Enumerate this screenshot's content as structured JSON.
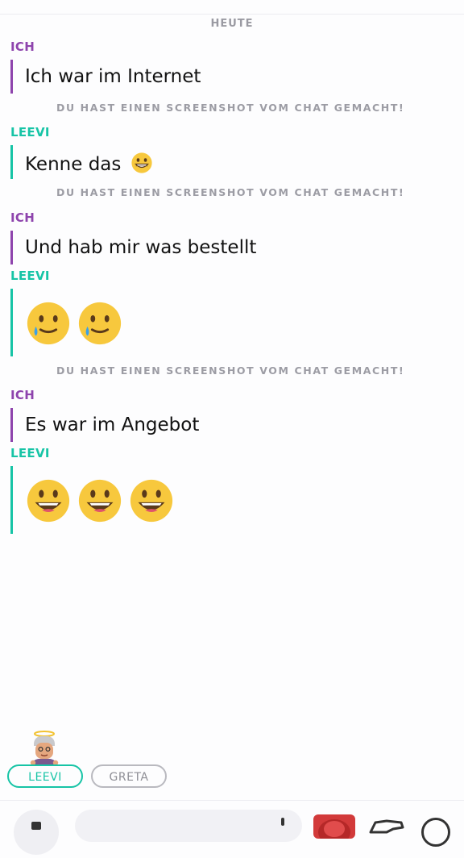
{
  "chat": {
    "date_label": "HEUTE",
    "messages": [
      {
        "sender": "ICH",
        "text": "Ich war im Internet"
      },
      {
        "notice": "DU HAST EINEN SCREENSHOT VOM CHAT GEMACHT!"
      },
      {
        "sender": "LEEVI",
        "text": "Kenne das",
        "emoji": "grinning-face-icon"
      },
      {
        "notice": "DU HAST EINEN SCREENSHOT VOM CHAT GEMACHT!"
      },
      {
        "sender": "ICH",
        "text": "Und hab mir was bestellt"
      },
      {
        "sender": "LEEVI",
        "emojis": [
          "smiling-face-with-tear-icon",
          "smiling-face-with-tear-icon"
        ]
      },
      {
        "notice": "DU HAST EINEN SCREENSHOT VOM CHAT GEMACHT!"
      },
      {
        "sender": "ICH",
        "text": "Es war im Angebot"
      },
      {
        "sender": "LEEVI",
        "emojis": [
          "grinning-face-big-eyes-icon",
          "grinning-face-big-eyes-icon",
          "grinning-face-big-eyes-icon"
        ]
      }
    ]
  },
  "presence": {
    "chips": [
      {
        "label": "LEEVI",
        "active": true
      },
      {
        "label": "GRETA",
        "active": false
      }
    ]
  },
  "colors": {
    "me": "#8e44ad",
    "friend": "#17c4a6",
    "notice": "#9c9ca4"
  },
  "bottom_bar": {
    "icons": [
      "camera-icon",
      "chat-input",
      "bitmoji-icon",
      "sticker-icon",
      "more-icon"
    ]
  }
}
